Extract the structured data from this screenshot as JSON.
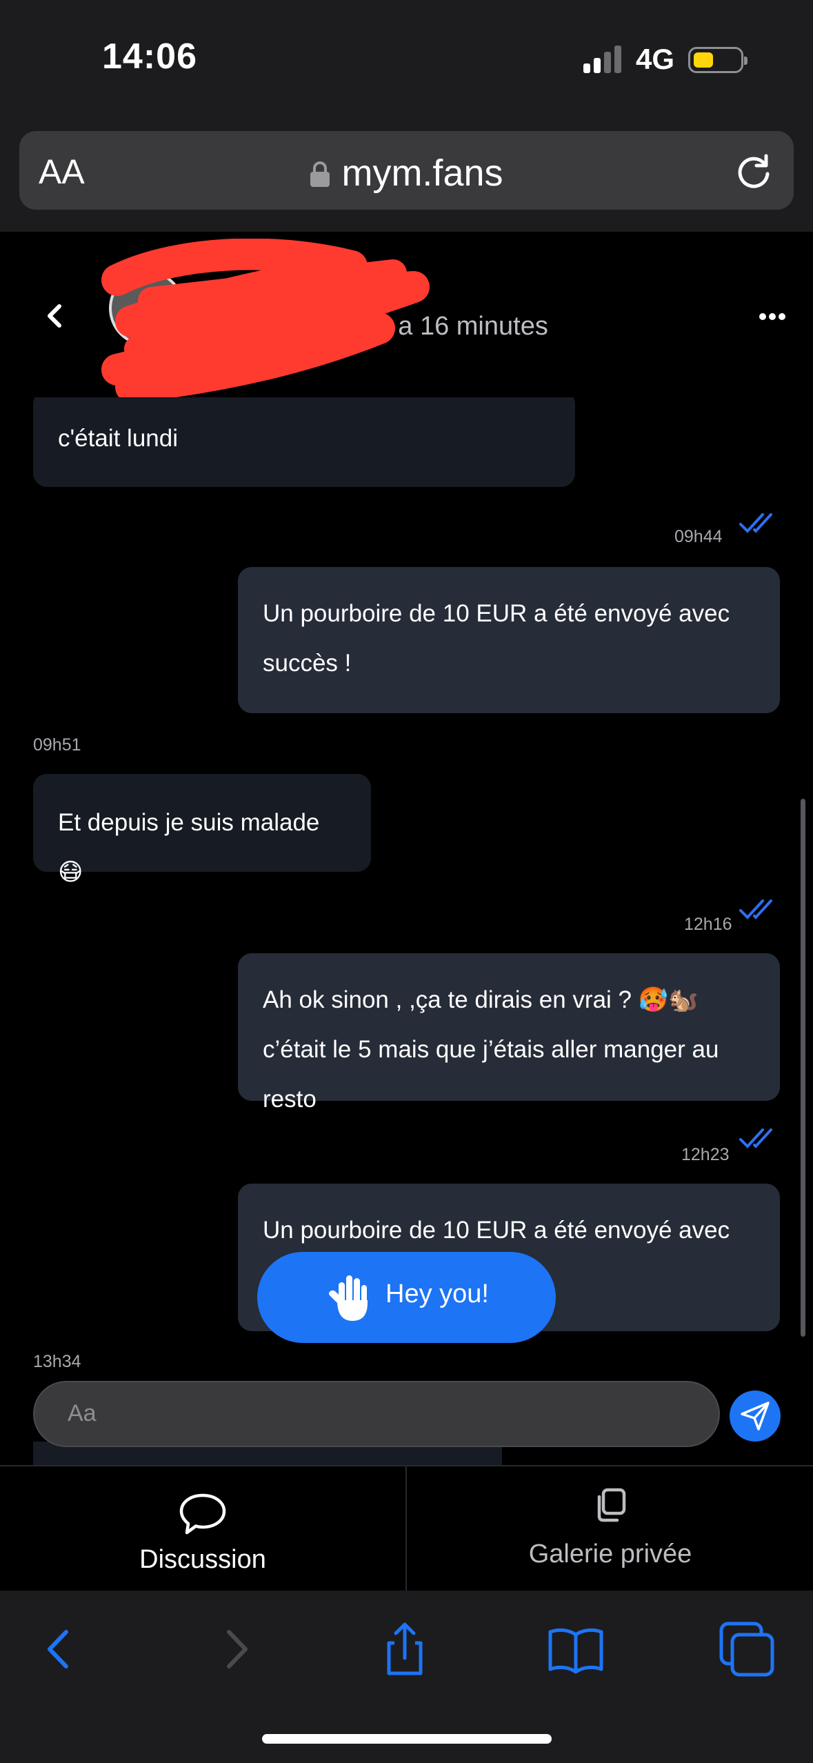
{
  "status": {
    "time": "14:06",
    "network": "4G"
  },
  "browser": {
    "text_size_label": "AA",
    "url": "mym.fans"
  },
  "chat": {
    "presence": "te il y a 16 minutes",
    "messages": [
      {
        "side": "in",
        "text": "c'était lundi"
      },
      {
        "side": "out",
        "time": "09h44",
        "text": "Un pourboire de 10 EUR a été envoyé avec succès !"
      },
      {
        "side": "in",
        "time": "09h51",
        "text": "Et depuis je suis malade 😷"
      },
      {
        "side": "out",
        "time": "12h16",
        "text": "Ah ok sinon , ,ça te dirais en vrai ? 🥵🐿️ c’était le 5 mais que j’étais aller manger au resto"
      },
      {
        "side": "out",
        "time": "12h23",
        "text": "Un pourboire de 10 EUR a été envoyé avec"
      },
      {
        "side": "in",
        "time": "13h34",
        "text": ""
      }
    ],
    "hey_button": "Hey you!",
    "composer_placeholder": "Aa"
  },
  "tabs": [
    {
      "label": "Discussion",
      "icon": "chat-bubble-icon",
      "active": true
    },
    {
      "label": "Galerie privée",
      "icon": "copy-gallery-icon",
      "active": false
    }
  ],
  "colors": {
    "accent": "#1d74f5",
    "bubble_out": "#262c38",
    "bubble_in": "#161b24"
  }
}
